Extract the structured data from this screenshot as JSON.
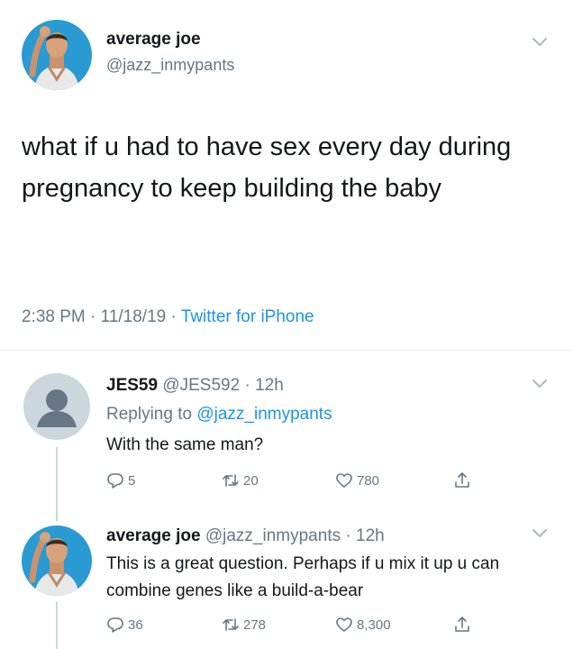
{
  "main_tweet": {
    "author_name": "average joe",
    "author_handle": "@jazz_inmypants",
    "text": "what if u had to have sex every day during pregnancy to keep building the baby",
    "time": "2:38 PM",
    "date": "11/18/19",
    "source": "Twitter for iPhone",
    "separator": " · "
  },
  "replies": [
    {
      "author_name": "JES59",
      "author_handle": "@JES592",
      "age": "12h",
      "replying_prefix": "Replying to ",
      "replying_to": "@jazz_inmypants",
      "text": "With the same man?",
      "replies_count": "5",
      "retweets_count": "20",
      "likes_count": "780"
    },
    {
      "author_name": "average joe",
      "author_handle": "@jazz_inmypants",
      "age": "12h",
      "text": "This is a great question. Perhaps if u mix it up u can combine genes like a build-a-bear",
      "replies_count": "36",
      "retweets_count": "278",
      "likes_count": "8,300"
    }
  ],
  "icons": {
    "reply": "speech-bubble-icon",
    "retweet": "retweet-icon",
    "like": "heart-icon",
    "share": "share-icon",
    "more": "chevron-down-icon"
  },
  "colors": {
    "text": "#14171a",
    "secondary": "#657786",
    "link": "#1b95e0",
    "avatar_bg": "#2a9ad3",
    "default_avatar_bg": "#ccd6dd"
  }
}
